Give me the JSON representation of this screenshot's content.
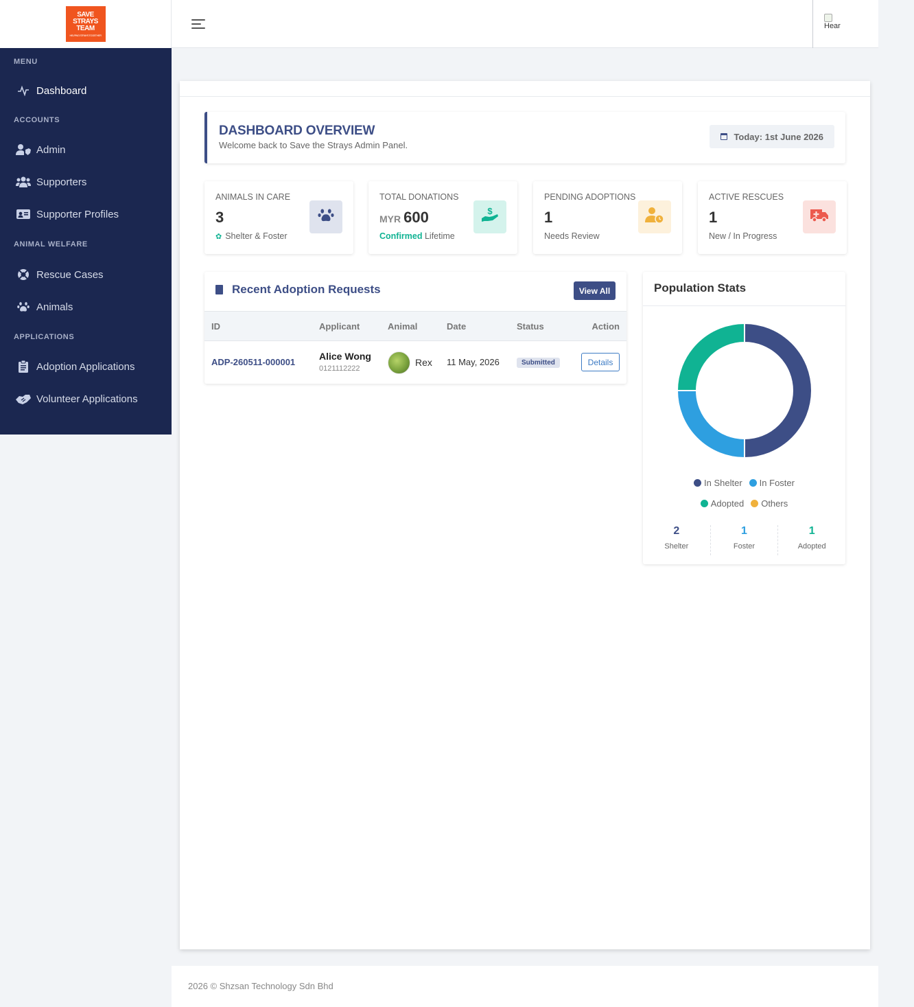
{
  "logo": {
    "lines": [
      "SAVE",
      "STRAYS",
      "TEAM"
    ],
    "small": "HELPING STRAYS TOGETHER",
    "color": "#f0551f"
  },
  "sidebar": {
    "sections": [
      "MENU",
      "ACCOUNTS",
      "ANIMAL WELFARE",
      "APPLICATIONS"
    ],
    "items": [
      {
        "label": "Dashboard",
        "icon": "activity-icon"
      },
      {
        "label": "Admin",
        "icon": "user-shield-icon"
      },
      {
        "label": "Supporters",
        "icon": "users-icon"
      },
      {
        "label": "Supporter Profiles",
        "icon": "id-card-icon"
      },
      {
        "label": "Rescue Cases",
        "icon": "life-ring-icon"
      },
      {
        "label": "Animals",
        "icon": "paw-icon"
      },
      {
        "label": "Adoption Applications",
        "icon": "clipboard-icon"
      },
      {
        "label": "Volunteer Applications",
        "icon": "handshake-icon"
      }
    ]
  },
  "topbar": {
    "avatar_alt": "Hear"
  },
  "overview": {
    "title": "DASHBOARD OVERVIEW",
    "subtitle": "Welcome back to Save the Strays Admin Panel.",
    "today": "Today: 1st June 2026"
  },
  "stats": [
    {
      "label": "ANIMALS IN CARE",
      "value": "3",
      "sub": "Shelter & Foster",
      "icon": "paw-icon",
      "color": "#3d4e86",
      "bg": "#dfe3ee"
    },
    {
      "label": "TOTAL DONATIONS",
      "currency": "MYR",
      "value": "600",
      "sub_bold": "Confirmed",
      "sub": "Lifetime",
      "icon": "hand-dollar-icon",
      "color": "#10b393",
      "bg": "#d4f3ec"
    },
    {
      "label": "PENDING ADOPTIONS",
      "value": "1",
      "sub": "Needs Review",
      "icon": "user-clock-icon",
      "color": "#f0b13c",
      "bg": "#fdf1dc"
    },
    {
      "label": "ACTIVE RESCUES",
      "value": "1",
      "sub": "New / In Progress",
      "icon": "ambulance-icon",
      "color": "#ec5a4e",
      "bg": "#fbe1de"
    }
  ],
  "recent": {
    "title": "Recent Adoption Requests",
    "view_all": "View All",
    "columns": [
      "ID",
      "Applicant",
      "Animal",
      "Date",
      "Status",
      "Action"
    ],
    "rows": [
      {
        "id": "ADP-260511-000001",
        "applicant": "Alice Wong",
        "phone": "0121112222",
        "animal": "Rex",
        "date": "11 May, 2026",
        "status": "Submitted",
        "action": "Details"
      }
    ]
  },
  "population": {
    "title": "Population Stats",
    "segments": [
      {
        "label": "In Shelter",
        "value": 2,
        "color": "#3d4e86"
      },
      {
        "label": "In Foster",
        "value": 1,
        "color": "#2e9fe0"
      },
      {
        "label": "Adopted",
        "value": 1,
        "color": "#10b393"
      },
      {
        "label": "Others",
        "value": 0,
        "color": "#f0b13c"
      }
    ],
    "counts": [
      {
        "value": "2",
        "label": "Shelter",
        "color": "#3d4e86"
      },
      {
        "value": "1",
        "label": "Foster",
        "color": "#2e9fe0"
      },
      {
        "value": "1",
        "label": "Adopted",
        "color": "#10b393"
      }
    ]
  },
  "footer": "2026 © Shzsan Technology Sdn Bhd"
}
